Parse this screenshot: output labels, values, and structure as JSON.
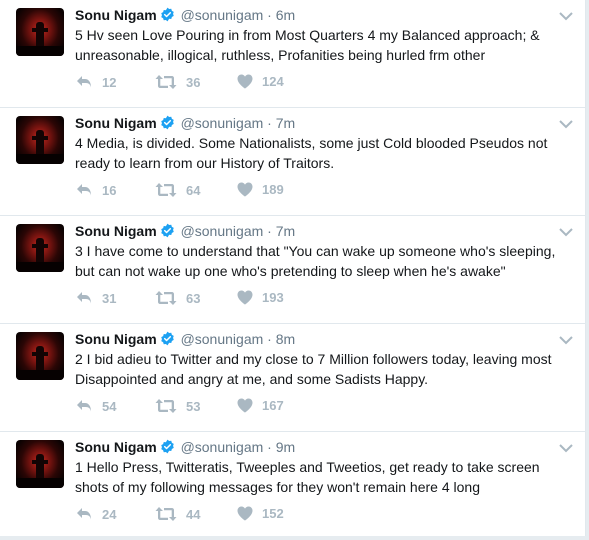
{
  "tweets": [
    {
      "name": "Sonu Nigam",
      "handle": "@sonunigam",
      "time": "6m",
      "text": "5 Hv seen Love Pouring in from Most Quarters 4 my Balanced approach; & unreasonable, illogical, ruthless, Profanities being hurled frm other",
      "replies": "12",
      "retweets": "36",
      "likes": "124"
    },
    {
      "name": "Sonu Nigam",
      "handle": "@sonunigam",
      "time": "7m",
      "text": "4 Media, is divided. Some Nationalists, some just Cold blooded Pseudos not ready to learn from our History of Traitors.",
      "replies": "16",
      "retweets": "64",
      "likes": "189"
    },
    {
      "name": "Sonu Nigam",
      "handle": "@sonunigam",
      "time": "7m",
      "text": "3 I have come to understand that \"You can wake up someone who's sleeping, but can not wake up one who's pretending to sleep when he's awake\"",
      "replies": "31",
      "retweets": "63",
      "likes": "193"
    },
    {
      "name": "Sonu Nigam",
      "handle": "@sonunigam",
      "time": "8m",
      "text": "2 I bid adieu to Twitter and my close to 7 Million followers today, leaving most Disappointed and angry at me, and some Sadists Happy.",
      "replies": "54",
      "retweets": "53",
      "likes": "167"
    },
    {
      "name": "Sonu Nigam",
      "handle": "@sonunigam",
      "time": "9m",
      "text": "1 Hello Press, Twitteratis, Tweeples and Tweetios, get ready to take screen shots of my following messages for they won't remain here 4 long",
      "replies": "24",
      "retweets": "44",
      "likes": "152"
    }
  ],
  "ui": {
    "dot": "·",
    "verified_icon": "verified-badge-icon",
    "colors": {
      "verified": "#1da1f2",
      "muted": "#657786",
      "action": "#aab8c2"
    }
  }
}
